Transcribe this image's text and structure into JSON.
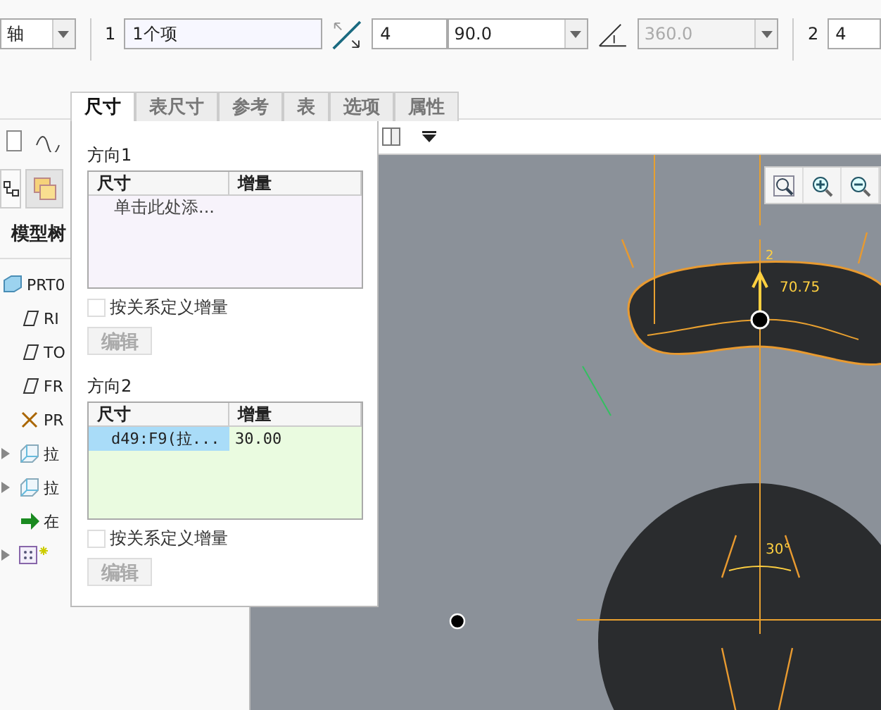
{
  "toolbar": {
    "pattern_type": "轴",
    "dir1_label": "1",
    "dir1_refs": "1个项",
    "dir1_count": "4",
    "dir1_angle": "90.0",
    "total_angle": {
      "value": "360.0",
      "disabled": true
    },
    "dir2_label": "2",
    "dir2_count": "4"
  },
  "popup": {
    "tabs": [
      {
        "label": "尺寸",
        "selected": true
      },
      {
        "label": "表尺寸",
        "selected": false
      },
      {
        "label": "参考",
        "selected": false
      },
      {
        "label": "表",
        "selected": false
      },
      {
        "label": "选项",
        "selected": false
      },
      {
        "label": "属性",
        "selected": false
      }
    ],
    "sections": [
      {
        "title": "方向1",
        "columns": [
          "尺寸",
          "增量"
        ],
        "placeholder": "单击此处添...",
        "relation_checkbox": {
          "label": "按关系定义增量",
          "checked": false,
          "disabled": true
        },
        "edit_button": {
          "label": "编辑",
          "disabled": true
        }
      },
      {
        "title": "方向2",
        "columns": [
          "尺寸",
          "增量"
        ],
        "rows": [
          {
            "dimension": "d49:F9(拉...",
            "increment": "30.00",
            "selected": true
          }
        ],
        "relation_checkbox": {
          "label": "按关系定义增量",
          "checked": false,
          "disabled": true
        },
        "edit_button": {
          "label": "编辑",
          "disabled": true
        }
      }
    ]
  },
  "sidebar": {
    "title": "模型树",
    "items": [
      {
        "label": "PRT0",
        "kind": "part"
      },
      {
        "label": "RI",
        "kind": "plane"
      },
      {
        "label": "TO",
        "kind": "plane"
      },
      {
        "label": "FR",
        "kind": "plane"
      },
      {
        "label": "PR",
        "kind": "csys"
      },
      {
        "label": "拉",
        "kind": "extrude",
        "expanded": false
      },
      {
        "label": "拉",
        "kind": "extrude",
        "expanded": false
      },
      {
        "label": "在",
        "kind": "insert"
      },
      {
        "kind": "pattern",
        "expanded": false
      }
    ]
  },
  "viewport": {
    "dimension_labels": [
      "2",
      "70.75",
      "30°"
    ]
  }
}
